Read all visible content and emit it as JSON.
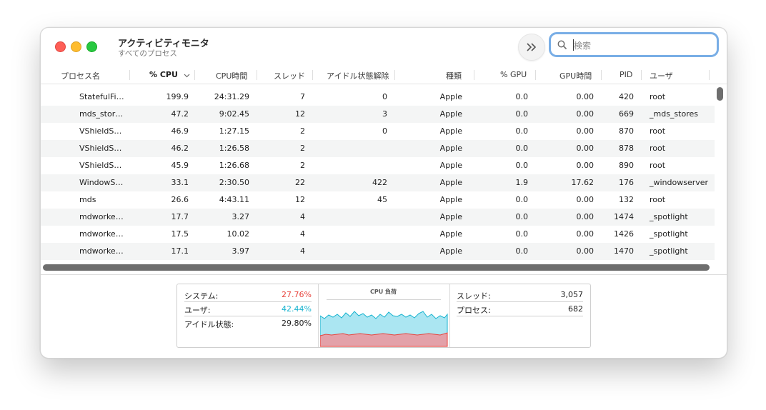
{
  "window": {
    "title": "アクティビティモニタ",
    "subtitle": "すべてのプロセス"
  },
  "search": {
    "placeholder": "検索",
    "value": ""
  },
  "columns": [
    {
      "label": "プロセス名"
    },
    {
      "label": "% CPU",
      "sorted": true
    },
    {
      "label": "CPU時間"
    },
    {
      "label": "スレッド"
    },
    {
      "label": "アイドル状態解除"
    },
    {
      "label": "種類"
    },
    {
      "label": "% GPU"
    },
    {
      "label": "GPU時間"
    },
    {
      "label": "PID"
    },
    {
      "label": "ユーザ"
    }
  ],
  "rows": [
    {
      "name": "StatefulFi…",
      "cpu": "199.9",
      "cpu_time": "24:31.29",
      "threads": "7",
      "idle_wakeups": "0",
      "kind": "Apple",
      "gpu": "0.0",
      "gpu_time": "0.00",
      "pid": "420",
      "user": "root"
    },
    {
      "name": "mds_stor…",
      "cpu": "47.2",
      "cpu_time": "9:02.45",
      "threads": "12",
      "idle_wakeups": "3",
      "kind": "Apple",
      "gpu": "0.0",
      "gpu_time": "0.00",
      "pid": "669",
      "user": "_mds_stores"
    },
    {
      "name": "VShieldS…",
      "cpu": "46.9",
      "cpu_time": "1:27.15",
      "threads": "2",
      "idle_wakeups": "0",
      "kind": "Apple",
      "gpu": "0.0",
      "gpu_time": "0.00",
      "pid": "870",
      "user": "root"
    },
    {
      "name": "VShieldS…",
      "cpu": "46.2",
      "cpu_time": "1:26.58",
      "threads": "2",
      "idle_wakeups": "",
      "kind": "Apple",
      "gpu": "0.0",
      "gpu_time": "0.00",
      "pid": "878",
      "user": "root"
    },
    {
      "name": "VShieldS…",
      "cpu": "45.9",
      "cpu_time": "1:26.68",
      "threads": "2",
      "idle_wakeups": "",
      "kind": "Apple",
      "gpu": "0.0",
      "gpu_time": "0.00",
      "pid": "890",
      "user": "root"
    },
    {
      "name": "WindowS…",
      "cpu": "33.1",
      "cpu_time": "2:30.50",
      "threads": "22",
      "idle_wakeups": "422",
      "kind": "Apple",
      "gpu": "1.9",
      "gpu_time": "17.62",
      "pid": "176",
      "user": "_windowserver"
    },
    {
      "name": "mds",
      "cpu": "26.6",
      "cpu_time": "4:43.11",
      "threads": "12",
      "idle_wakeups": "45",
      "kind": "Apple",
      "gpu": "0.0",
      "gpu_time": "0.00",
      "pid": "132",
      "user": "root"
    },
    {
      "name": "mdworke…",
      "cpu": "17.7",
      "cpu_time": "3.27",
      "threads": "4",
      "idle_wakeups": "",
      "kind": "Apple",
      "gpu": "0.0",
      "gpu_time": "0.00",
      "pid": "1474",
      "user": "_spotlight"
    },
    {
      "name": "mdworke…",
      "cpu": "17.5",
      "cpu_time": "10.02",
      "threads": "4",
      "idle_wakeups": "",
      "kind": "Apple",
      "gpu": "0.0",
      "gpu_time": "0.00",
      "pid": "1426",
      "user": "_spotlight"
    },
    {
      "name": "mdworke…",
      "cpu": "17.1",
      "cpu_time": "3.97",
      "threads": "4",
      "idle_wakeups": "",
      "kind": "Apple",
      "gpu": "0.0",
      "gpu_time": "0.00",
      "pid": "1470",
      "user": "_spotlight"
    }
  ],
  "footer": {
    "system_label": "システム:",
    "system_value": "27.76%",
    "user_label": "ユーザ:",
    "user_value": "42.44%",
    "idle_label": "アイドル状態:",
    "idle_value": "29.80%",
    "chart_title": "CPU 負荷",
    "threads_label": "スレッド:",
    "threads_value": "3,057",
    "processes_label": "プロセス:",
    "processes_value": "682"
  },
  "colors": {
    "system": "#e8433c",
    "user": "#17b3cf",
    "search_focus": "#79aee6"
  },
  "icons": {
    "toolbar_more": "chevron-double-right-icon",
    "search": "magnifier-icon",
    "sort": "chevron-down-icon"
  }
}
